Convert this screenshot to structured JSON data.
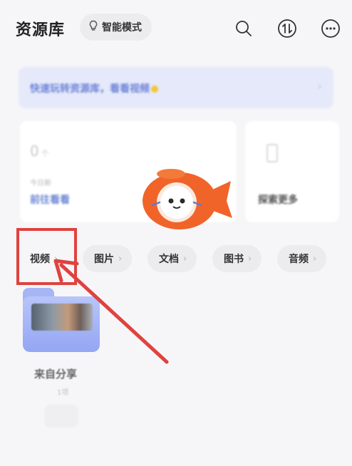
{
  "header": {
    "title": "资源库",
    "mode_label": "智能模式",
    "icons": [
      "lightbulb-icon",
      "search-icon",
      "sort-icon",
      "more-icon"
    ]
  },
  "banner": {
    "text": "快速玩转资源库，看看视频"
  },
  "cards": {
    "left": {
      "count": "0",
      "count_unit": "个",
      "sub": "今日新",
      "link": "前往看看"
    },
    "right": {
      "label": "探索更多"
    }
  },
  "tabs": [
    {
      "label": "视频"
    },
    {
      "label": "图片"
    },
    {
      "label": "文档"
    },
    {
      "label": "图书"
    },
    {
      "label": "音频"
    }
  ],
  "folder": {
    "name": "来自分享",
    "count": "1项"
  },
  "colors": {
    "accent": "#6b85d3",
    "annotation_red": "#e0423e",
    "folder_blue": "#94a6f3",
    "mascot_orange": "#f0642a"
  }
}
